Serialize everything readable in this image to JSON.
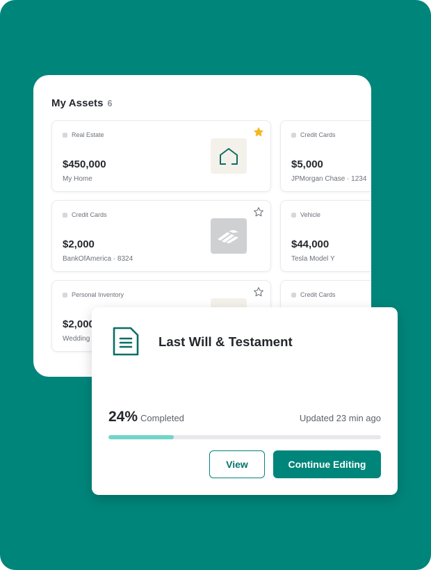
{
  "assets": {
    "title": "My Assets",
    "count": "6",
    "items": [
      {
        "category": "Real Estate",
        "value": "$450,000",
        "name": "My Home",
        "starred": true,
        "thumb": "house-icon"
      },
      {
        "category": "Credit Cards",
        "value": "$5,000",
        "name": "JPMorgan Chase · 1234",
        "starred": false,
        "thumb": ""
      },
      {
        "category": "Credit Cards",
        "value": "$2,000",
        "name": "BankOfAmerica · 8324",
        "starred": false,
        "thumb": "bank-of-america-logo"
      },
      {
        "category": "Vehicle",
        "value": "$44,000",
        "name": "Tesla Model Y",
        "starred": false,
        "thumb": ""
      },
      {
        "category": "Personal Inventory",
        "value": "$2,000",
        "name": "Wedding",
        "starred": false,
        "thumb": ""
      },
      {
        "category": "Credit Cards",
        "value": "",
        "name": "",
        "starred": false,
        "thumb": ""
      }
    ]
  },
  "will": {
    "title": "Last Will & Testament",
    "progress_pct": "24%",
    "progress_value": 0.24,
    "progress_label": "Completed",
    "updated": "Updated 23 min ago",
    "view_label": "View",
    "continue_label": "Continue Editing",
    "icon": "document-icon"
  },
  "colors": {
    "brand": "#00857a",
    "progress_fill": "#71d5ca",
    "star_active": "#f5b71f"
  }
}
